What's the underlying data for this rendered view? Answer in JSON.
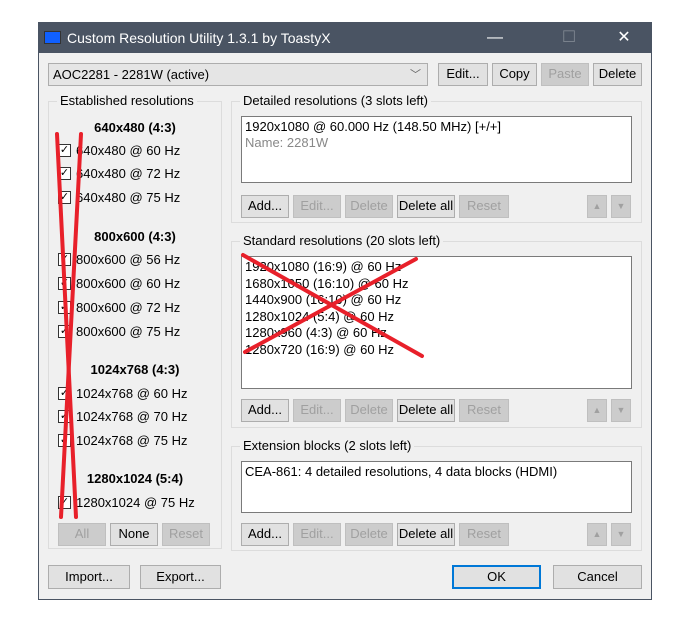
{
  "window": {
    "title": "Custom Resolution Utility 1.3.1 by ToastyX",
    "minimize": "—",
    "maximize": "☐",
    "close": "✕"
  },
  "monitor": {
    "selected": "AOC2281 - 2281W (active)",
    "edit": "Edit...",
    "copy": "Copy",
    "paste": "Paste",
    "delete": "Delete"
  },
  "established": {
    "label": "Established resolutions",
    "groups": [
      {
        "heading": "640x480 (4:3)",
        "items": [
          "640x480 @ 60 Hz",
          "640x480 @ 72 Hz",
          "640x480 @ 75 Hz"
        ]
      },
      {
        "heading": "800x600 (4:3)",
        "items": [
          "800x600 @ 56 Hz",
          "800x600 @ 60 Hz",
          "800x600 @ 72 Hz",
          "800x600 @ 75 Hz"
        ]
      },
      {
        "heading": "1024x768 (4:3)",
        "items": [
          "1024x768 @ 60 Hz",
          "1024x768 @ 70 Hz",
          "1024x768 @ 75 Hz"
        ]
      },
      {
        "heading": "1280x1024 (5:4)",
        "items": [
          "1280x1024 @ 75 Hz"
        ]
      }
    ],
    "all": "All",
    "none": "None",
    "reset": "Reset"
  },
  "detailed": {
    "label": "Detailed resolutions (3 slots left)",
    "items": [
      "1920x1080 @ 60.000 Hz (148.50 MHz) [+/+]"
    ],
    "name": "Name: 2281W"
  },
  "standard": {
    "label": "Standard resolutions (20 slots left)",
    "items": [
      "1920x1080 (16:9) @ 60 Hz",
      "1680x1050 (16:10) @ 60 Hz",
      "1440x900 (16:10) @ 60 Hz",
      "1280x1024 (5:4) @ 60 Hz",
      "1280x960 (4:3) @ 60 Hz",
      "1280x720 (16:9) @ 60 Hz"
    ]
  },
  "extension": {
    "label": "Extension blocks (2 slots left)",
    "items": [
      "CEA-861: 4 detailed resolutions, 4 data blocks (HDMI)"
    ]
  },
  "buttons": {
    "add": "Add...",
    "edit": "Edit...",
    "delete": "Delete",
    "delete_all": "Delete all",
    "reset": "Reset",
    "up": "▲",
    "down": "▼"
  },
  "footer": {
    "import": "Import...",
    "export": "Export...",
    "ok": "OK",
    "cancel": "Cancel"
  },
  "annotation_color": "#e8202a"
}
